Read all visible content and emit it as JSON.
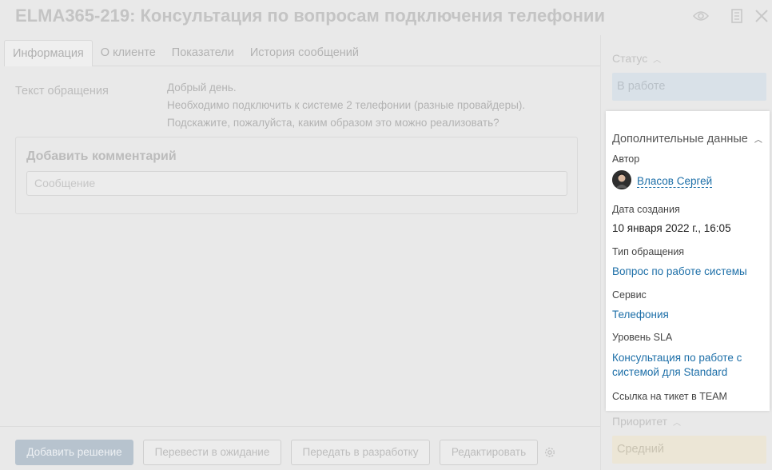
{
  "header": {
    "title": "ELMA365-219: Консультация по вопросам подключения телефонии",
    "icons": [
      "eye-icon",
      "document-icon",
      "close-icon"
    ]
  },
  "tabs": [
    {
      "label": "Информация",
      "active": true
    },
    {
      "label": "О клиенте",
      "active": false
    },
    {
      "label": "Показатели",
      "active": false
    },
    {
      "label": "История сообщений",
      "active": false
    }
  ],
  "main": {
    "request_label": "Текст обращения",
    "request_lines": [
      "Добрый день.",
      "Необходимо подключить к системе 2 телефонии (разные провайдеры).",
      "Подскажите, пожалуйста, каким образом это можно реализовать?"
    ],
    "comment": {
      "title": "Добавить комментарий",
      "placeholder": "Сообщение"
    }
  },
  "toolbar": {
    "add_solution": "Добавить решение",
    "to_waiting": "Перевести в ожидание",
    "to_development": "Передать в разработку",
    "edit": "Редактировать"
  },
  "sidebar": {
    "status_label": "Статус",
    "status_value": "В работе",
    "panel": {
      "title": "Дополнительные данные",
      "author_label": "Автор",
      "author_name": "Власов Сергей",
      "created_label": "Дата создания",
      "created_value": "10 января 2022 г., 16:05",
      "type_label": "Тип обращения",
      "type_value": "Вопрос по работе системы",
      "service_label": "Сервис",
      "service_value": "Телефония",
      "sla_label": "Уровень SLA",
      "sla_line1": "Консультация по работе с",
      "sla_line2": "системой для Standard",
      "team_label": "Ссылка на тикет в TEAM"
    },
    "priority_label": "Приоритет",
    "priority_value": "Средний"
  },
  "colors": {
    "link": "#1d6fa8",
    "status_bg": "#d9e1e8",
    "priority_bg": "#ece6d6",
    "primary_button": "#b7c3ce"
  }
}
